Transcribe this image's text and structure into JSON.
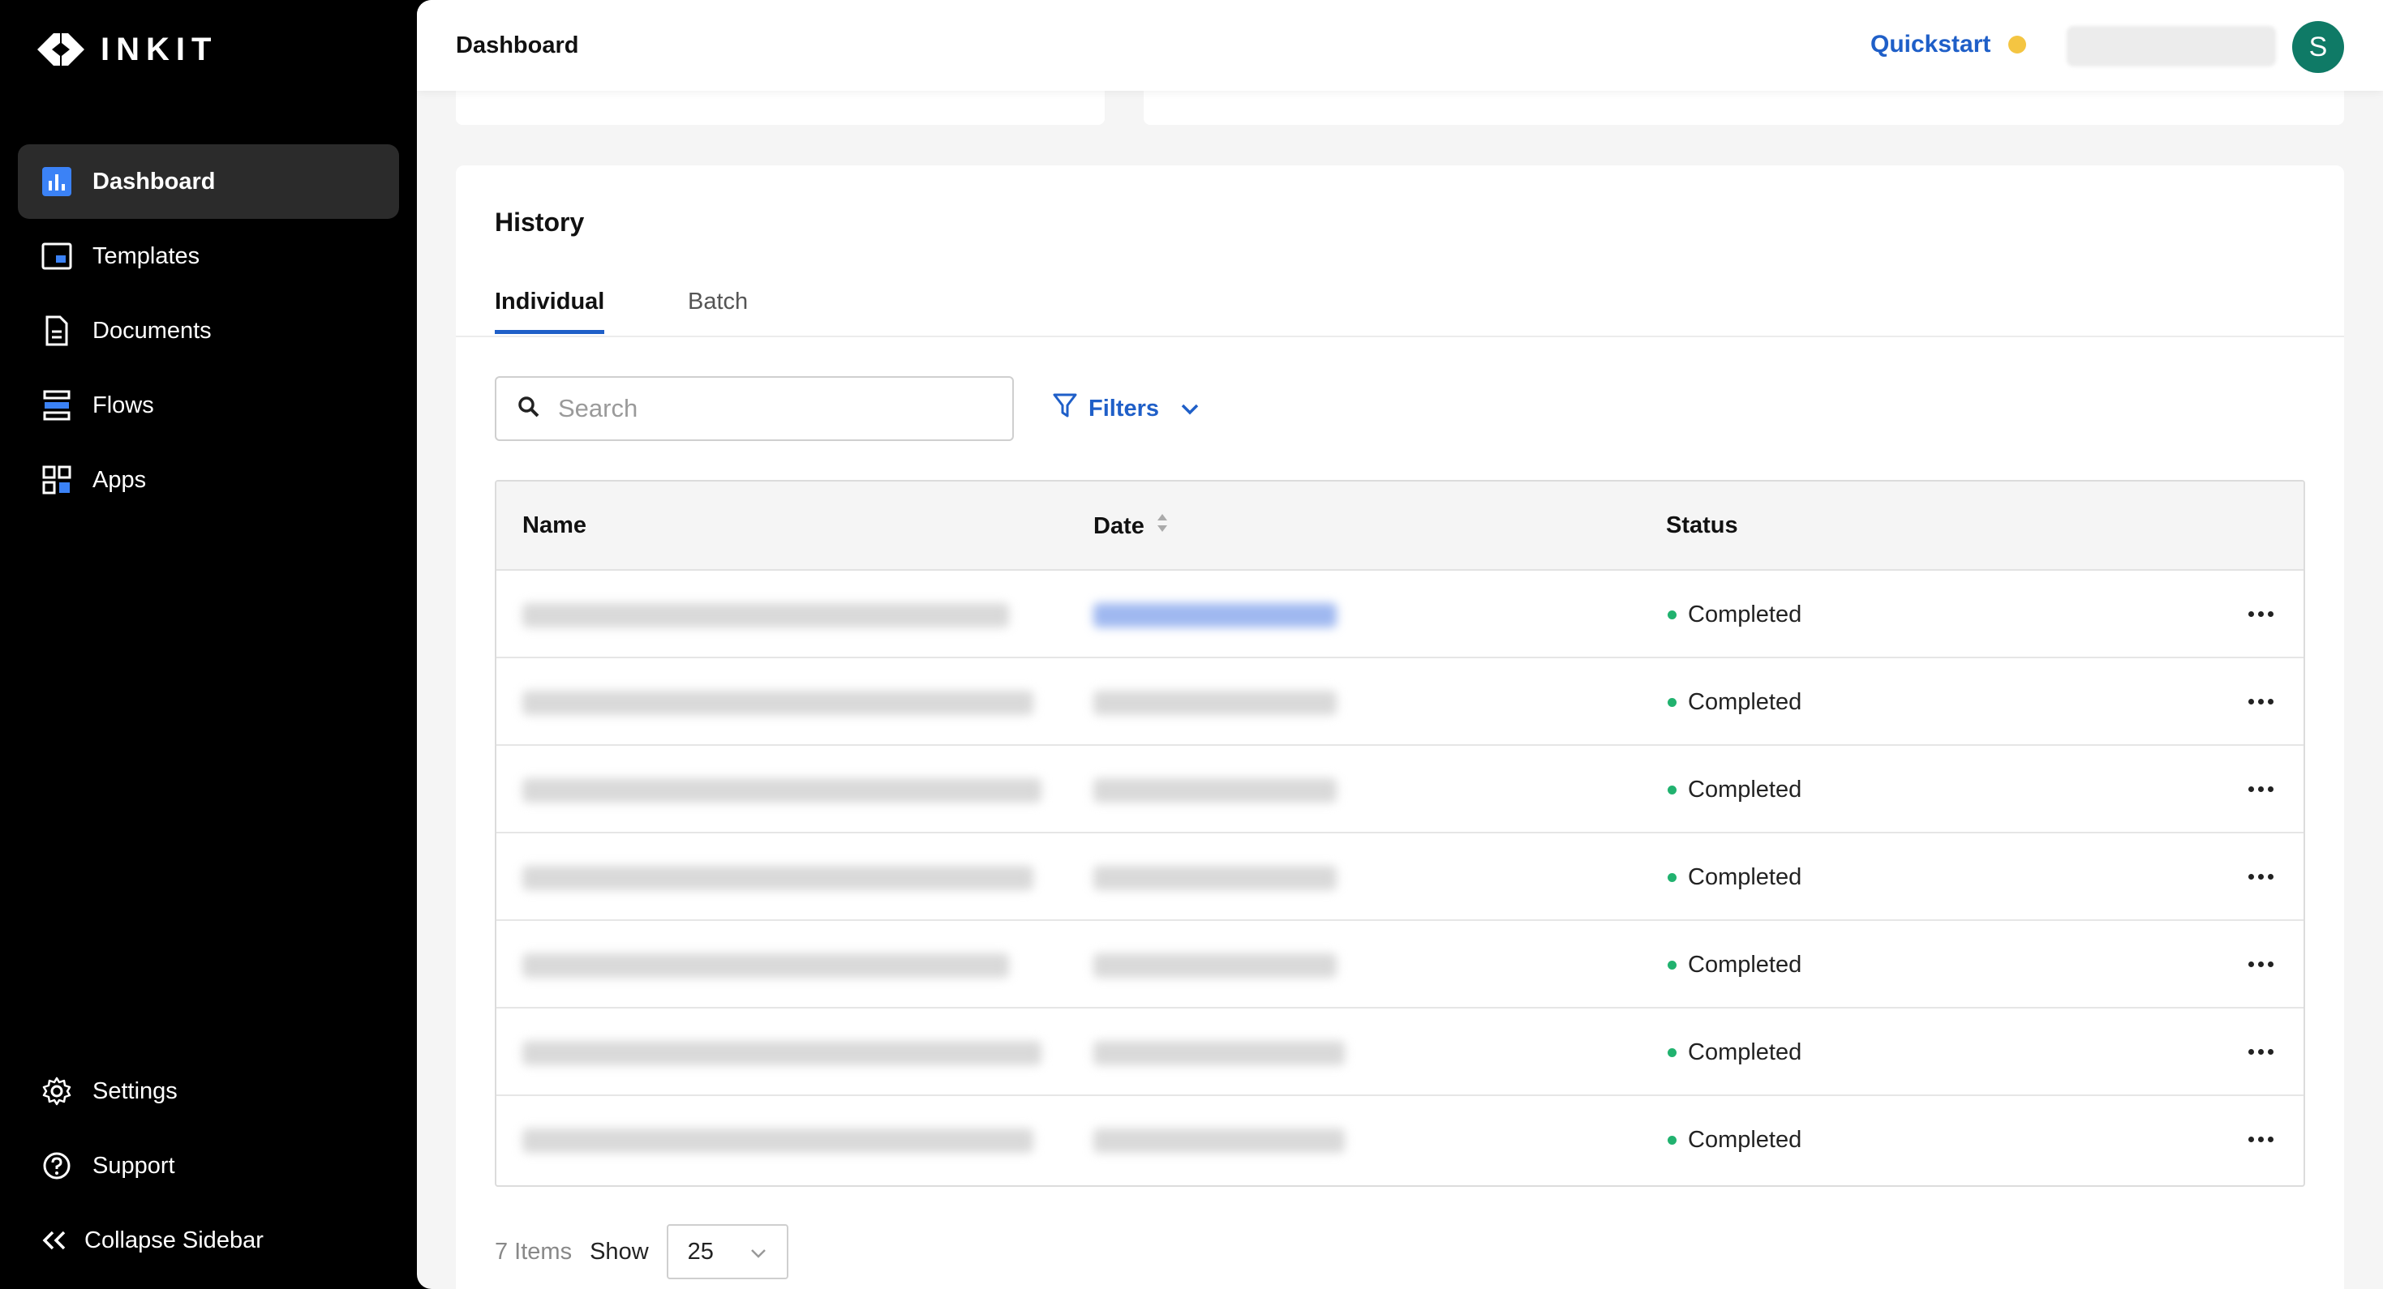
{
  "sidebar": {
    "brand": "INKIT",
    "items": [
      {
        "label": "Dashboard",
        "icon": "bar-chart-icon",
        "active": true
      },
      {
        "label": "Templates",
        "icon": "template-icon",
        "active": false
      },
      {
        "label": "Documents",
        "icon": "document-icon",
        "active": false
      },
      {
        "label": "Flows",
        "icon": "flows-icon",
        "active": false
      },
      {
        "label": "Apps",
        "icon": "apps-grid-icon",
        "active": false
      }
    ],
    "bottom": [
      {
        "label": "Settings",
        "icon": "gear-icon"
      },
      {
        "label": "Support",
        "icon": "help-circle-icon"
      },
      {
        "label": "Collapse Sidebar",
        "icon": "double-chevron-left-icon"
      }
    ]
  },
  "header": {
    "title": "Dashboard",
    "quickstart": "Quickstart",
    "avatar_initial": "S"
  },
  "history": {
    "title": "History",
    "tabs": [
      {
        "label": "Individual",
        "active": true
      },
      {
        "label": "Batch",
        "active": false
      }
    ],
    "search": {
      "placeholder": "Search",
      "value": ""
    },
    "filters_label": "Filters",
    "columns": [
      "Name",
      "Date",
      "Status"
    ],
    "rows": [
      {
        "status": "Completed"
      },
      {
        "status": "Completed"
      },
      {
        "status": "Completed"
      },
      {
        "status": "Completed"
      },
      {
        "status": "Completed"
      },
      {
        "status": "Completed"
      },
      {
        "status": "Completed"
      }
    ],
    "footer": {
      "items_count": "7 Items",
      "show_label": "Show",
      "page_size": "25"
    }
  },
  "colors": {
    "accent": "#1f5fc8",
    "status_completed": "#21b26f",
    "quickstart_dot": "#f4c542",
    "avatar": "#0f7a66"
  }
}
